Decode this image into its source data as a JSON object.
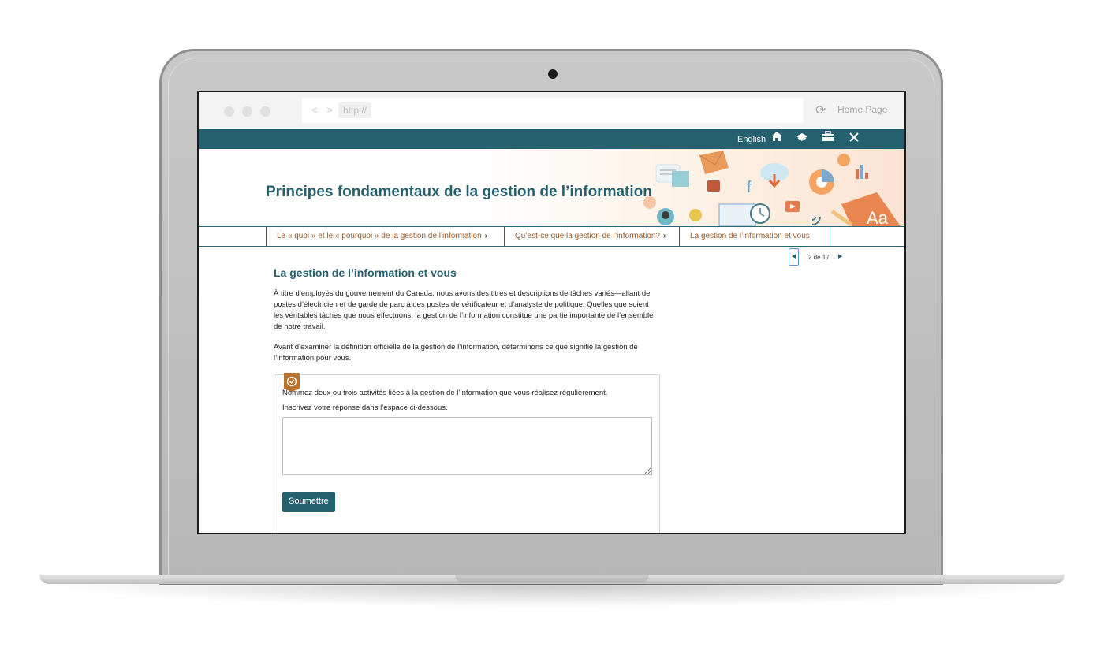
{
  "browser": {
    "nav_arrows": "< >",
    "url_placeholder": "http://",
    "reload_icon": "reload-icon",
    "home_link": "Home Page"
  },
  "topbar": {
    "language": "English",
    "icons": [
      "home-icon",
      "glossary-icon",
      "toolbox-icon",
      "close-icon"
    ]
  },
  "banner": {
    "title": "Principes fondamentaux de la gestion de l’information"
  },
  "menu": {
    "items": [
      {
        "label": "Le « quoi » et le « pourquoi » de la gestion de l’information"
      },
      {
        "label": "Qu’est-ce que la gestion de l’information?"
      },
      {
        "label": "La gestion de l’information et vous"
      }
    ]
  },
  "pager": {
    "text": "2 de 17"
  },
  "main": {
    "heading": "La gestion de l’information et vous",
    "para1": "À titre d’employés du gouvernement du Canada, nous avons des titres et descriptions de tâches variés—allant de postes d’électricien et de garde de parc à des postes de vérificateur et d’analyste de politique. Quelles que soient les véritables tâches que nous effectuons, la gestion de l’information constitue une partie importante de l’ensemble de notre travail.",
    "para2": "Avant d’examiner la définition officielle de la gestion de l’information, déterminons ce que signifie la gestion de l’information pour vous."
  },
  "activity": {
    "question": "Nommez deux ou trois activités liées à la gestion de l’information que vous réalisez régulièrement.",
    "instruction": "Inscrivez votre réponse dans l’espace ci-dessous.",
    "answer_value": "",
    "submit_label": "Soumettre"
  },
  "colors": {
    "brand": "#24606e",
    "menu_text": "#9b5a28",
    "badge": "#b8732f"
  }
}
